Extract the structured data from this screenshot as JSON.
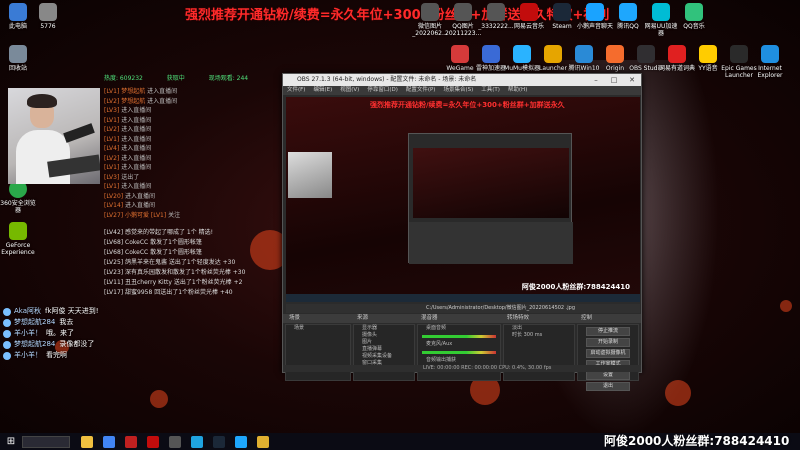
{
  "banner": "强烈推荐开通钻粉/续费=永久年位+300+粉丝群+加群送永久特权+福利",
  "desktop_icons": [
    {
      "label": "此电脑",
      "color": "#3a7bd5"
    },
    {
      "label": "5776",
      "color": "#888"
    },
    {
      "label": "回收站",
      "color": "#7a8a9a"
    },
    {
      "label": "360安全浏览器",
      "color": "#2aa84a"
    },
    {
      "label": "GeForce Experience",
      "color": "#76b900"
    }
  ],
  "top_icons": [
    {
      "label": "微信图片_2022062...",
      "color": "#555"
    },
    {
      "label": "QQ图片 20211223...",
      "color": "#555"
    },
    {
      "label": "_3332222...",
      "color": "#555"
    },
    {
      "label": "网易云音乐",
      "color": "#c20c0c"
    },
    {
      "label": "Steam",
      "color": "#1b2838"
    },
    {
      "label": "小鹅声音聊天",
      "color": "#1aa3ff"
    },
    {
      "label": "腾讯QQ",
      "color": "#1ea7fd"
    },
    {
      "label": "网易UU加速器",
      "color": "#00bcd4"
    },
    {
      "label": "QQ音乐",
      "color": "#31c27c"
    }
  ],
  "second_icons": [
    {
      "label": "WeGame",
      "color": "#d63a3a"
    },
    {
      "label": "雷神加速器",
      "color": "#3a6ad6"
    },
    {
      "label": "MuMu模拟器",
      "color": "#2ab3ff"
    },
    {
      "label": "Launcher",
      "color": "#e6a500"
    },
    {
      "label": "腾讯Win10",
      "color": "#2a8ad6"
    },
    {
      "label": "Origin",
      "color": "#f56c2d"
    },
    {
      "label": "OBS Studio",
      "color": "#302e31"
    },
    {
      "label": "网易有道词典",
      "color": "#e02020"
    },
    {
      "label": "YY语音",
      "color": "#ffcc00"
    },
    {
      "label": "Epic Games Launcher",
      "color": "#2a2a2a"
    },
    {
      "label": "Internet Explorer",
      "color": "#1f8fe0"
    }
  ],
  "stats": {
    "viewers_label": "热度: 609232",
    "gift_label": "获取中",
    "online_label": "现场观看: 244"
  },
  "chat": [
    {
      "name": "[LV1] 梦想起航",
      "text": "进入直播间"
    },
    {
      "name": "[LV2] 梦想起航",
      "text": "进入直播间"
    },
    {
      "name": "[LV3]",
      "text": "进入直播间"
    },
    {
      "name": "[LV1]",
      "text": "进入直播间"
    },
    {
      "name": "[LV2]",
      "text": "进入直播间"
    },
    {
      "name": "[LV1]",
      "text": "进入直播间"
    },
    {
      "name": "[LV4]",
      "text": "进入直播间"
    },
    {
      "name": "[LV2]",
      "text": "进入直播间"
    },
    {
      "name": "[LV1]",
      "text": "进入直播间"
    },
    {
      "name": "[LV3]",
      "text": "送出了"
    },
    {
      "name": "[LV1]",
      "text": "进入直播间"
    },
    {
      "name": "[LV20]",
      "text": "进入直播间"
    },
    {
      "name": "[LV14]",
      "text": "进入直播间"
    },
    {
      "name": "[LV27] 小鹅可爱 [LV1]",
      "text": "关注"
    }
  ],
  "chat2": [
    "[LV42] 感觉来的带起了哪成了 1个 精选!",
    "[LV68] CokeCC 散发了1个圆形帐篷",
    "[LV68] CokeCC 散发了1个圆形帐篷",
    "[LV25] 鸽黑羊来在鬼酱 送出了1个轻度发达 +30",
    "[LV23] 深有真乐园散发和散发了1个粉丝荧光棒 +30",
    "[LV11] 丑丑cherry Kitty 送出了1个粉丝荧光棒 +2",
    "[LV17] 甜蜜9958 回送出了1个粉丝荧光棒 +40"
  ],
  "danmu": [
    {
      "name": "Aka阿秋",
      "text": "fk阿俊 天天进到!"
    },
    {
      "name": "梦想起航284",
      "text": "我去"
    },
    {
      "name": "羊小羊！",
      "text": "哦。来了"
    },
    {
      "name": "梦想起航284",
      "text": "录像都没了"
    },
    {
      "name": "羊小羊！",
      "text": "看完啊"
    }
  ],
  "obs": {
    "title": "OBS 27.1.3 (64-bit, windows) - 配置文件: 未命名 - 场景: 未命名",
    "menu": [
      "文件(F)",
      "编辑(E)",
      "视图(V)",
      "停靠窗口(D)",
      "配置文件(P)",
      "场景集合(S)",
      "工具(T)",
      "帮助(H)"
    ],
    "preview_banner": "强烈推荐开通钻粉/续费=永久年位+300+粉丝群+加群送永久",
    "preview_watermark": "阿俊2000人粉丝群:788424410",
    "path_text": "C:/Users/Administrator/Desktop/微信图片_20220614502 .jpg",
    "tabs": [
      "场景",
      "来源",
      "混音器",
      "转场特效",
      "控制"
    ],
    "scenes": [
      "场景"
    ],
    "sources": [
      "显示器",
      "摄像头",
      "图片",
      "直播弹幕",
      "视频采集设备",
      "窗口采集"
    ],
    "mixer": [
      {
        "name": "桌面音频",
        "level": "0.0 dB"
      },
      {
        "name": "麦克风/Aux",
        "level": "0.0 dB"
      },
      {
        "name": "音频输出捕获",
        "level": ""
      }
    ],
    "transition": {
      "name": "淡出",
      "duration_label": "时长",
      "duration": "300 ms"
    },
    "controls": [
      "停止推流",
      "开始录制",
      "启动虚拟摄像机",
      "工作室模式",
      "设置",
      "退出"
    ],
    "status": "LIVE: 00:00:00   REC: 00:00:00   CPU: 0.4%, 30.00 fps"
  },
  "taskbar_watermark": "阿俊2000人粉丝群:788424410",
  "taskbar_icons": [
    {
      "name": "file-explorer-icon",
      "color": "#f0c040"
    },
    {
      "name": "chrome-icon",
      "color": "#4285f4"
    },
    {
      "name": "app-icon-red",
      "color": "#c02020"
    },
    {
      "name": "netease-music-icon",
      "color": "#c20c0c"
    },
    {
      "name": "obs-icon",
      "color": "#555"
    },
    {
      "name": "edge-icon",
      "color": "#1fa4e0"
    },
    {
      "name": "steam-icon",
      "color": "#1b2838"
    },
    {
      "name": "qq-icon",
      "color": "#1ea7fd"
    },
    {
      "name": "folder-icon",
      "color": "#e0b030"
    }
  ]
}
